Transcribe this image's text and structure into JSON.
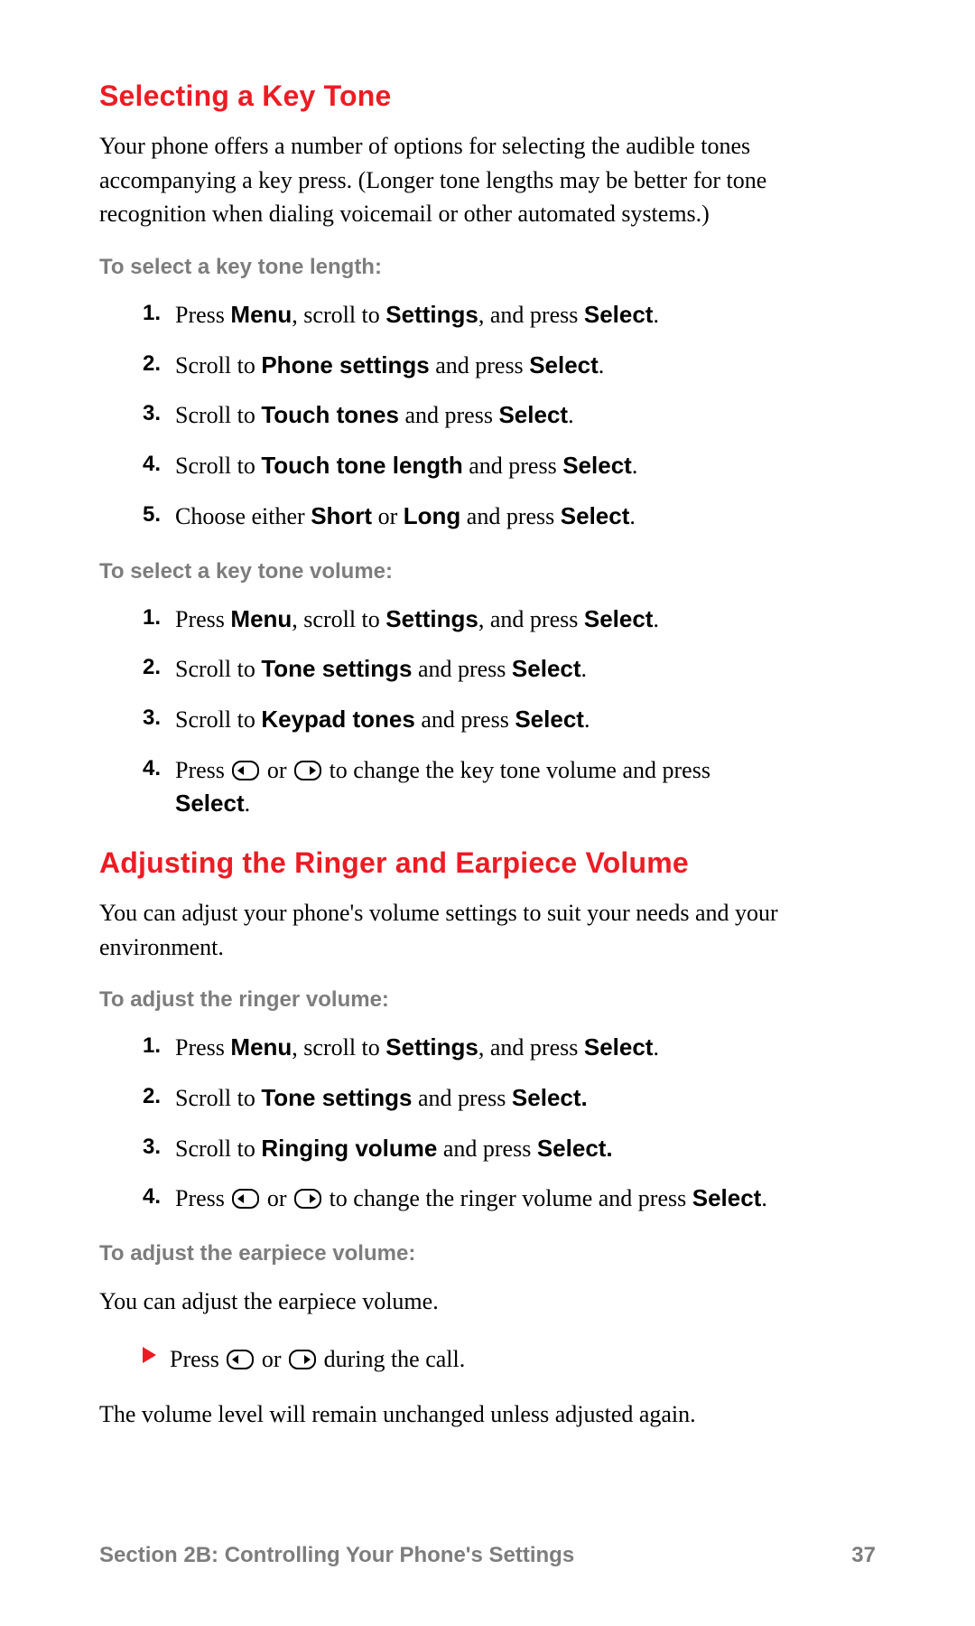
{
  "section1": {
    "heading": "Selecting a Key Tone",
    "intro": "Your phone offers a number of options for selecting the audible tones accompanying a key press. (Longer tone lengths may be better for tone recognition when dialing voicemail or other automated systems.)",
    "labelA": "To select a key tone length:",
    "stepsA": {
      "n1": "1.",
      "s1a": "Press ",
      "s1b": "Menu",
      "s1c": ", scroll to ",
      "s1d": "Settings",
      "s1e": ", and press ",
      "s1f": "Select",
      "s1g": ".",
      "n2": "2.",
      "s2a": "Scroll to ",
      "s2b": "Phone settings",
      "s2c": " and press ",
      "s2d": "Select",
      "s2e": ".",
      "n3": "3.",
      "s3a": "Scroll to ",
      "s3b": "Touch tones",
      "s3c": " and press ",
      "s3d": "Select",
      "s3e": ".",
      "n4": "4.",
      "s4a": "Scroll to ",
      "s4b": "Touch tone length",
      "s4c": " and press ",
      "s4d": "Select",
      "s4e": ".",
      "n5": "5.",
      "s5a": "Choose either ",
      "s5b": "Short",
      "s5c": " or ",
      "s5d": "Long",
      "s5e": " and press ",
      "s5f": "Select",
      "s5g": "."
    },
    "labelB": "To select a key tone volume:",
    "stepsB": {
      "n1": "1.",
      "s1a": "Press ",
      "s1b": "Menu",
      "s1c": ", scroll to ",
      "s1d": "Settings",
      "s1e": ", and press ",
      "s1f": "Select",
      "s1g": ".",
      "n2": "2.",
      "s2a": "Scroll to ",
      "s2b": "Tone settings",
      "s2c": " and press ",
      "s2d": "Select",
      "s2e": ".",
      "n3": "3.",
      "s3a": "Scroll to ",
      "s3b": "Keypad tones",
      "s3c": " and press ",
      "s3d": "Select",
      "s3e": ".",
      "n4": "4.",
      "s4a": "Press ",
      "s4b": " or ",
      "s4c": " to change the key tone volume and press ",
      "s4d": "Select",
      "s4e": "."
    }
  },
  "section2": {
    "heading": "Adjusting the Ringer and Earpiece Volume",
    "intro": "You can adjust your phone's volume settings to suit your needs and your environment.",
    "labelA": "To adjust the ringer volume:",
    "stepsA": {
      "n1": "1.",
      "s1a": "Press ",
      "s1b": "Menu",
      "s1c": ", scroll to ",
      "s1d": "Settings",
      "s1e": ", and press ",
      "s1f": "Select",
      "s1g": ".",
      "n2": "2.",
      "s2a": "Scroll to ",
      "s2b": "Tone settings",
      "s2c": " and press ",
      "s2d": "Select.",
      "n3": "3.",
      "s3a": "Scroll to ",
      "s3b": "Ringing volume",
      "s3c": " and press ",
      "s3d": "Select.",
      "n4": "4.",
      "s4a": "Press ",
      "s4b": " or ",
      "s4c": " to change the ringer volume and press ",
      "s4d": "Select",
      "s4e": "."
    },
    "labelB": "To adjust the earpiece volume:",
    "earpieceIntro": "You can adjust the earpiece volume.",
    "bullet": {
      "a": "Press ",
      "b": " or ",
      "c": " during the call."
    },
    "outro": "The volume level will remain unchanged unless adjusted again."
  },
  "footer": {
    "left": "Section 2B: Controlling Your Phone's Settings",
    "right": "37"
  }
}
